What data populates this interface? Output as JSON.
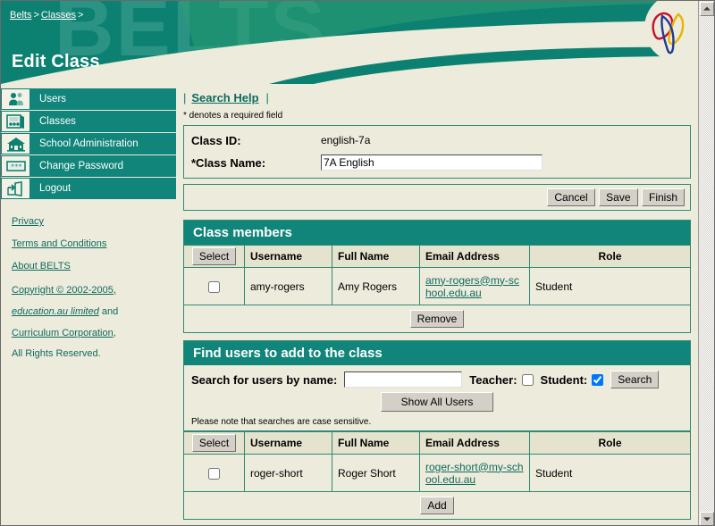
{
  "window": {
    "background_color": "#EDEBDC",
    "accent_color": "#0D8171",
    "link_color": "#0D6B5E"
  },
  "header": {
    "ghost_watermark": "BELTS",
    "page_title": "Edit Class",
    "breadcrumb": [
      {
        "label": "Belts",
        "sep": ">"
      },
      {
        "label": "Classes",
        "sep": ">"
      }
    ],
    "logo_name": "belts-logo"
  },
  "sidebar": {
    "items": [
      {
        "label": "Users",
        "icon": "users-icon"
      },
      {
        "label": "Classes",
        "icon": "classes-icon"
      },
      {
        "label": "School Administration",
        "icon": "school-icon"
      },
      {
        "label": "Change Password",
        "icon": "password-icon"
      },
      {
        "label": "Logout",
        "icon": "logout-icon"
      }
    ],
    "links": [
      {
        "label": "Privacy"
      },
      {
        "label": "Terms and Conditions"
      },
      {
        "label": "About BELTS"
      }
    ],
    "copyright": {
      "line1": "Copyright © 2002-2005,",
      "line2": "education.au limited",
      "line2_tail": " and",
      "line3": "Curriculum Corporation",
      "line3_tail": ",",
      "line4": "All Rights Reserved."
    }
  },
  "content": {
    "search_help_link": "Search Help",
    "pipe_left": "|",
    "pipe_right": "|",
    "required_note": "* denotes a required field",
    "form": {
      "class_id_label": "Class ID:",
      "class_id_value": "english-7a",
      "class_name_label": "*Class Name:",
      "class_name_value": "7A English",
      "class_name_placeholder": ""
    },
    "form_buttons": {
      "cancel": "Cancel",
      "save": "Save",
      "finish": "Finish"
    },
    "members_section": {
      "title": "Class members",
      "columns": [
        "Select",
        "Username",
        "Full Name",
        "Email Address",
        "Role"
      ],
      "select_button_label": "Select",
      "rows": [
        {
          "checked": false,
          "username": "amy-rogers",
          "full_name": "Amy Rogers",
          "email": "amy-rogers@my-school.edu.au",
          "role": "Student"
        }
      ],
      "action_button": "Remove"
    },
    "find_section": {
      "title": "Find users to add to the class",
      "search_label": "Search for users by name:",
      "search_value": "",
      "search_placeholder": "",
      "teacher_label": "Teacher:",
      "teacher_checked": false,
      "student_label": "Student:",
      "student_checked": true,
      "search_button": "Search",
      "show_all_button": "Show All Users",
      "case_note": "Please note that searches are case sensitive.",
      "columns": [
        "Select",
        "Username",
        "Full Name",
        "Email Address",
        "Role"
      ],
      "select_button_label": "Select",
      "rows": [
        {
          "checked": false,
          "username": "roger-short",
          "full_name": "Roger Short",
          "email": "roger-short@my-school.edu.au",
          "role": "Student"
        }
      ],
      "action_button": "Add"
    }
  },
  "scrollbar": {
    "up_arrow": "▲",
    "down_arrow": "▼"
  }
}
